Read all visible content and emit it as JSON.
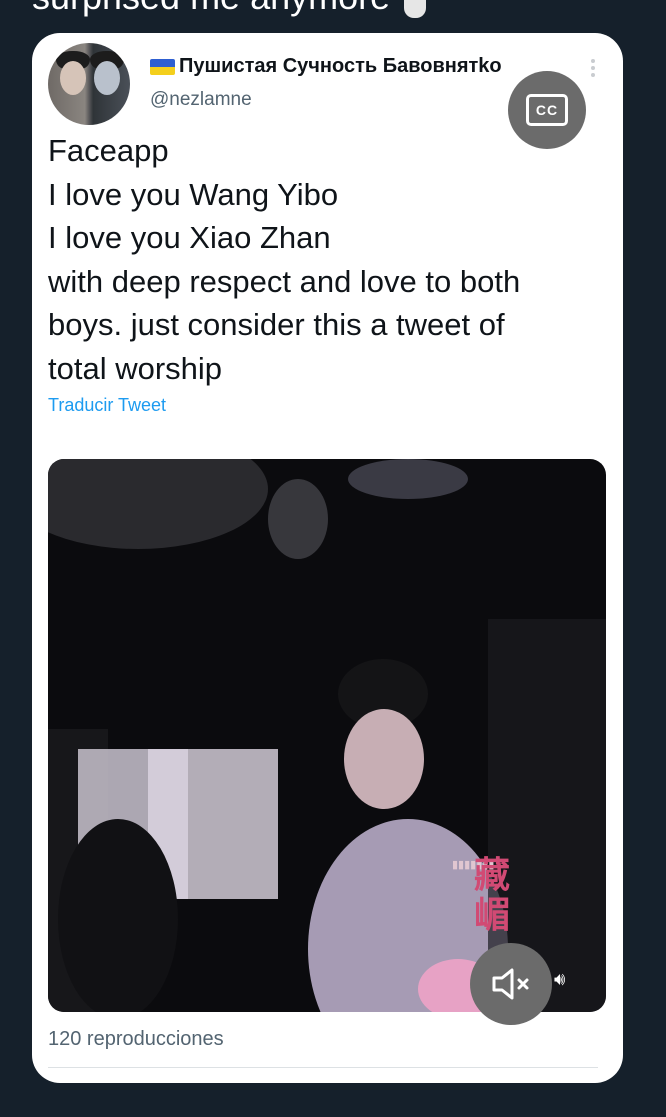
{
  "header_partial_text": "surprised me anymore",
  "tweet": {
    "author_flag_icon": "ukraine-flag-icon",
    "display_name": "Пушистая Сучность Бавовнятko",
    "handle": "@nezlamne",
    "text_lines": [
      "Faceapp",
      "I love you Wang Yibo",
      "I love you Xiao Zhan",
      "with deep respect and love to both",
      "boys. just consider this a tweet of",
      "total worship"
    ],
    "translate_label": "Traducir Tweet",
    "cc_label": "CC",
    "watermark_text": "藏嵋",
    "video_volume_icon": "speaker-icon",
    "views_label": "120 reproducciones"
  },
  "colors": {
    "background": "#15202b",
    "card": "#ffffff",
    "link": "#1d9bf0",
    "secondary_text": "#536471",
    "overlay_button": "#6b6b6b"
  }
}
